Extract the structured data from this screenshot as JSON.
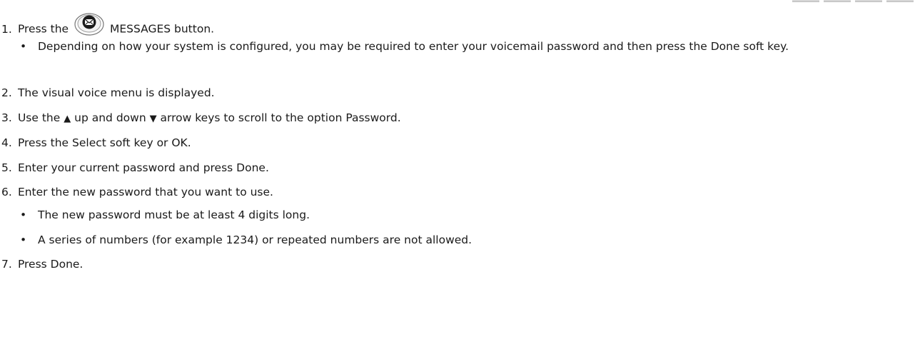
{
  "steps": [
    {
      "num": "1.",
      "before": "Press the",
      "icon": "messages-envelope-icon",
      "after": "MESSAGES button."
    },
    {
      "num": "2.",
      "text": "The visual voice menu is displayed."
    },
    {
      "num": "3.",
      "p1": "Use the",
      "up_glyph": "▲",
      "p2": "up and down",
      "down_glyph": "▼",
      "p3": "arrow keys to scroll to the option Password."
    },
    {
      "num": "4.",
      "text": "Press the Select soft key or OK."
    },
    {
      "num": "5.",
      "text": "Enter your current password and press Done."
    },
    {
      "num": "6.",
      "text": "Enter the new password that you want to use."
    },
    {
      "num": "7.",
      "text": "Press Done."
    }
  ],
  "bullets": {
    "step1": [
      "Depending on how your system is configured, you may be required to enter your voicemail password and then press the Done soft key."
    ],
    "step6": [
      "The new password must be at least 4 digits long.",
      "A series of numbers (for example 1234) or repeated numbers are not allowed."
    ]
  },
  "bullet_char": "•"
}
